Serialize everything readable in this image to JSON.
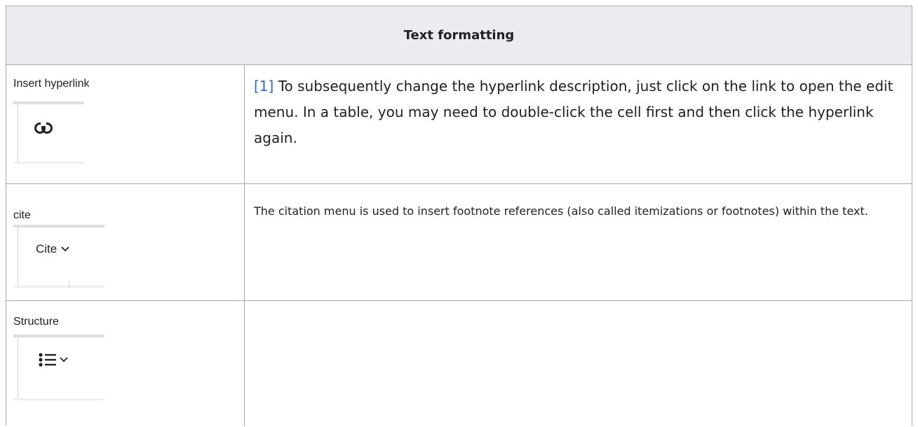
{
  "table": {
    "header": "Text formatting",
    "rows": [
      {
        "label": "Insert hyperlink",
        "button": {
          "icon": "link-icon",
          "text": ""
        },
        "ref": "[1]",
        "description": " To subsequently change the hyperlink description, just click on the link to open the edit menu. In a table, you may need to double-click the cell first and then click the hyperlink again."
      },
      {
        "label": "cite",
        "button": {
          "icon": "chevron-down-icon",
          "text": "Cite"
        },
        "ref": "",
        "description": "The citation menu is used to insert footnote references (also called itemizations or footnotes) within the text."
      },
      {
        "label": "Structure",
        "button": {
          "icon": "bulleted-list-icon",
          "text": ""
        },
        "ref": "",
        "description": ""
      }
    ]
  }
}
